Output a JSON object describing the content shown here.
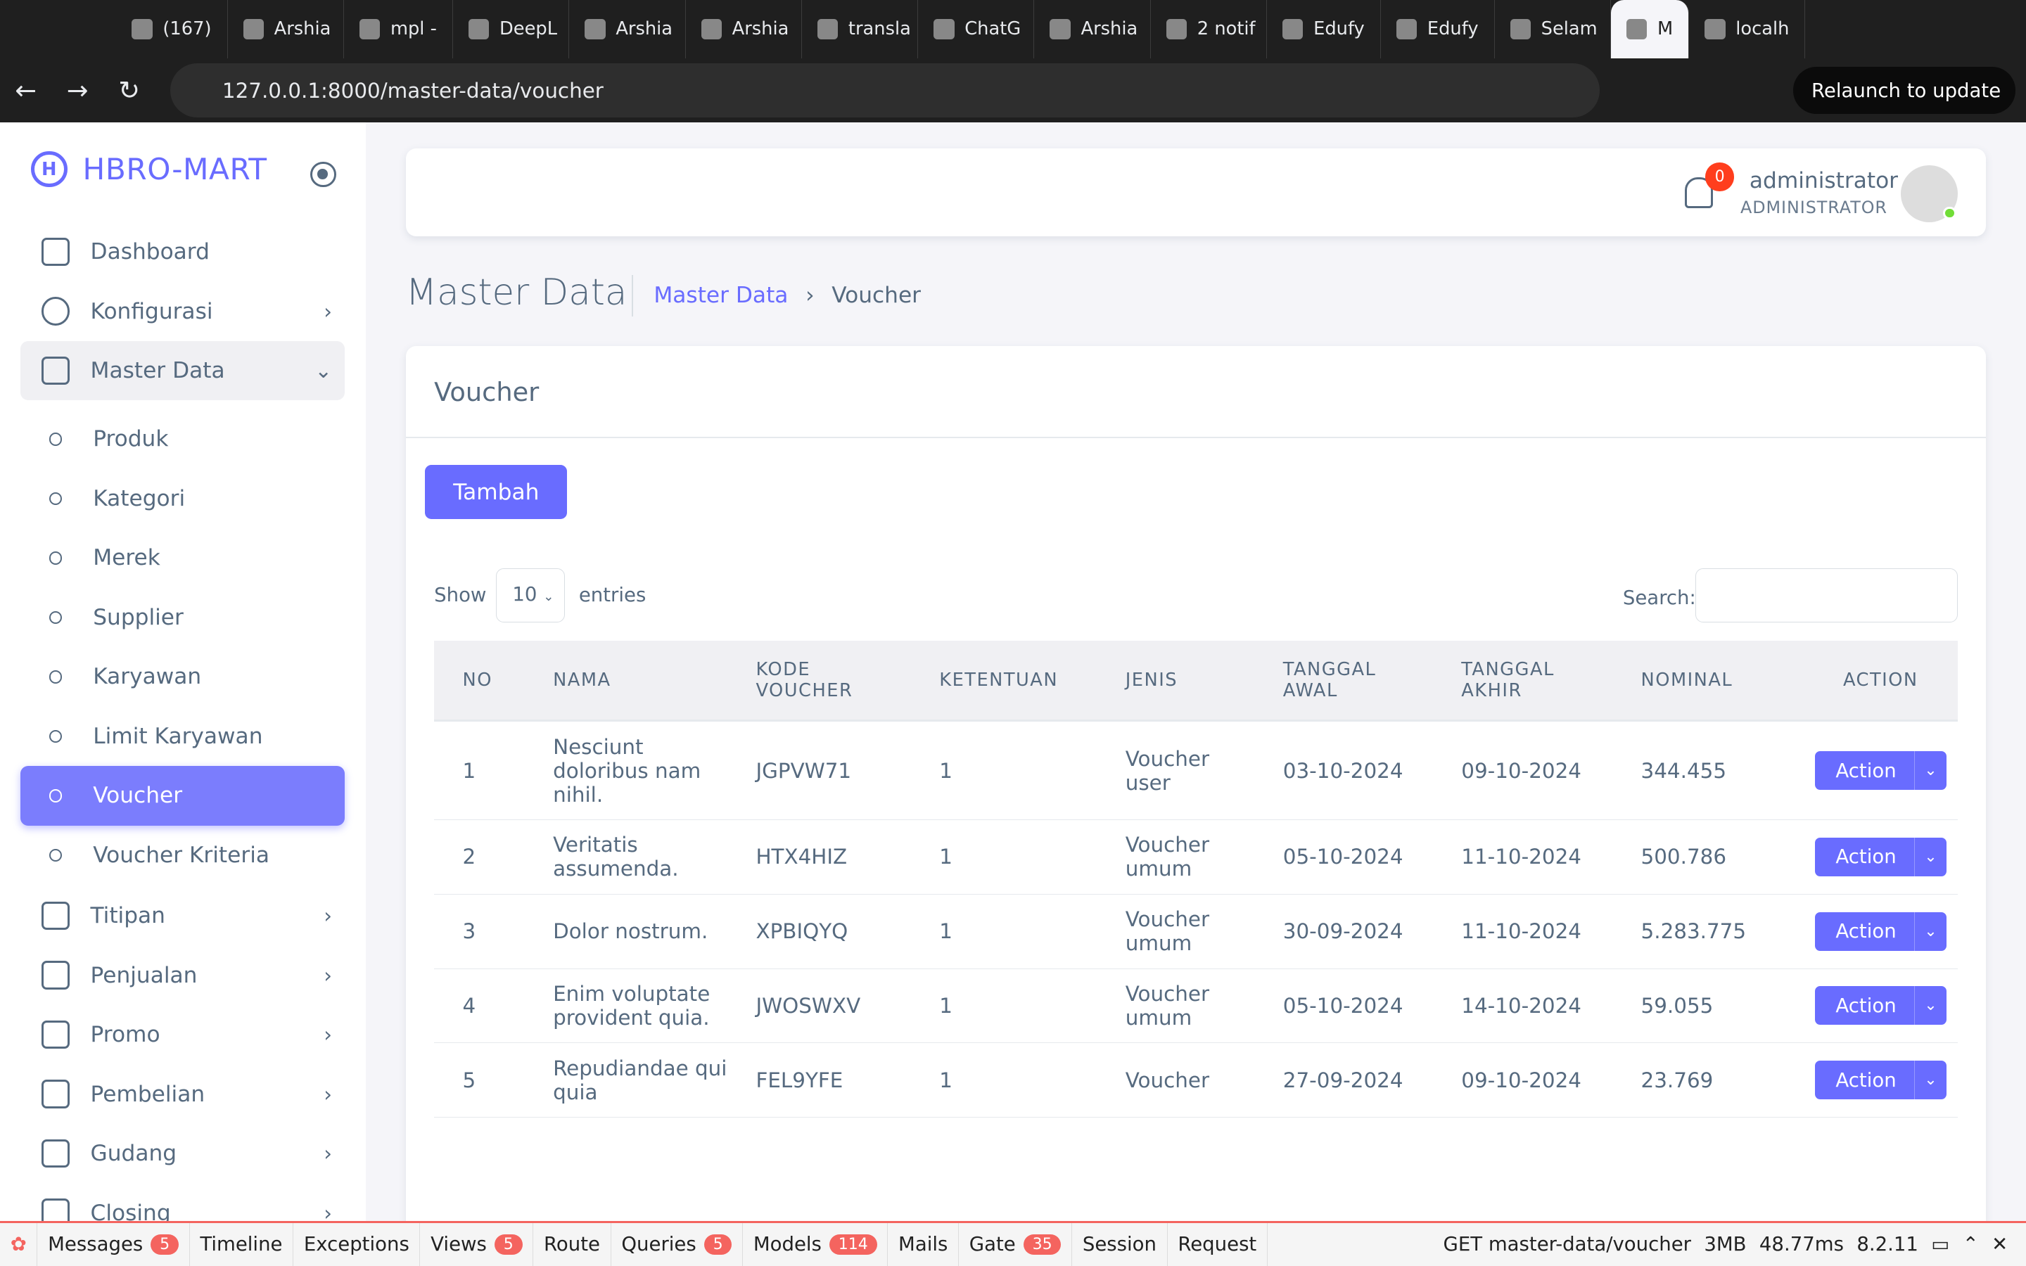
{
  "browser": {
    "tabs": [
      "(167)",
      "Arshia",
      "mpl -",
      "DeepL",
      "Arshia",
      "Arshia",
      "transla",
      "ChatG",
      "Arshia",
      "2 notif",
      "Edufy",
      "Edufy",
      "Selam",
      "M",
      "localh"
    ],
    "url": "127.0.0.1:8000/master-data/voucher",
    "relaunch": "Relaunch to update"
  },
  "sidebar": {
    "brand": "HBRO-MART",
    "items": [
      {
        "label": "Dashboard"
      },
      {
        "label": "Konfigurasi"
      },
      {
        "label": "Master Data"
      }
    ],
    "sub": [
      "Produk",
      "Kategori",
      "Merek",
      "Supplier",
      "Karyawan",
      "Limit Karyawan",
      "Voucher",
      "Voucher Kriteria"
    ],
    "more": [
      "Titipan",
      "Penjualan",
      "Promo",
      "Pembelian",
      "Gudang",
      "Closing"
    ]
  },
  "topbar": {
    "notif": "0",
    "user": "administrator",
    "role": "ADMINISTRATOR"
  },
  "page": {
    "title": "Master Data",
    "crumb1": "Master Data",
    "crumb2": "Voucher"
  },
  "card": {
    "title": "Voucher",
    "add": "Tambah",
    "show": "Show",
    "page_size": "10",
    "entries": "entries",
    "search": "Search:",
    "headers": [
      "NO",
      "NAMA",
      "KODE VOUCHER",
      "KETENTUAN",
      "JENIS",
      "TANGGAL AWAL",
      "TANGGAL AKHIR",
      "NOMINAL",
      "ACTION"
    ],
    "rows": [
      [
        "1",
        "Nesciunt doloribus nam nihil.",
        "JGPVW71",
        "1",
        "Voucher user",
        "03-10-2024",
        "09-10-2024",
        "344.455"
      ],
      [
        "2",
        "Veritatis assumenda.",
        "HTX4HIZ",
        "1",
        "Voucher umum",
        "05-10-2024",
        "11-10-2024",
        "500.786"
      ],
      [
        "3",
        "Dolor nostrum.",
        "XPBIQYQ",
        "1",
        "Voucher umum",
        "30-09-2024",
        "11-10-2024",
        "5.283.775"
      ],
      [
        "4",
        "Enim voluptate provident quia.",
        "JWOSWXV",
        "1",
        "Voucher umum",
        "05-10-2024",
        "14-10-2024",
        "59.055"
      ],
      [
        "5",
        "Repudiandae qui quia",
        "FEL9YFE",
        "1",
        "Voucher",
        "27-09-2024",
        "09-10-2024",
        "23.769"
      ]
    ],
    "action": "Action"
  },
  "debugbar": {
    "items": [
      [
        "Messages",
        "5"
      ],
      [
        "Timeline",
        ""
      ],
      [
        "Exceptions",
        ""
      ],
      [
        "Views",
        "5"
      ],
      [
        "Route",
        ""
      ],
      [
        "Queries",
        "5"
      ],
      [
        "Models",
        "114"
      ],
      [
        "Mails",
        ""
      ],
      [
        "Gate",
        "35"
      ],
      [
        "Session",
        ""
      ],
      [
        "Request",
        ""
      ]
    ],
    "route": "GET master-data/voucher",
    "memory": "3MB",
    "time": "48.77ms",
    "php": "8.2.11"
  }
}
